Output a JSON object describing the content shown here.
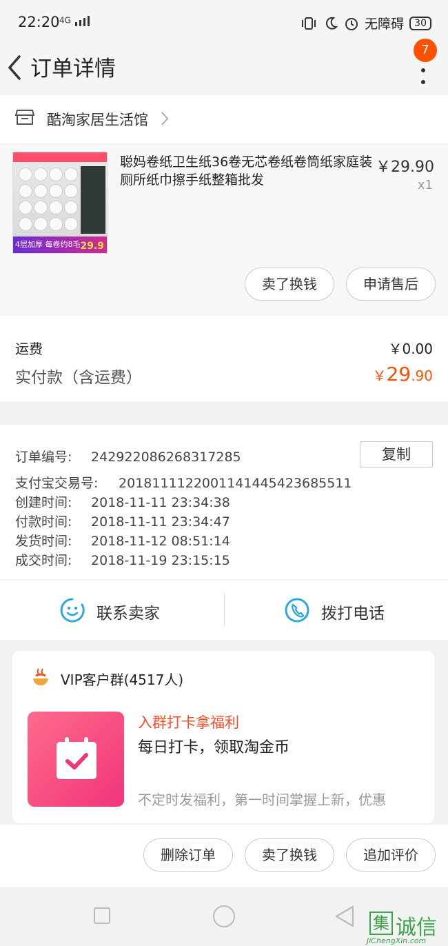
{
  "status_bar": {
    "time": "22:20",
    "signal": "4G",
    "accessibility": "无障碍",
    "battery": "30"
  },
  "header": {
    "title": "订单详情",
    "badge": "7"
  },
  "shop": {
    "name": "酷淘家居生活馆"
  },
  "product": {
    "title": "聪妈卷纸卫生纸36卷无芯卷纸卷筒纸家庭装厕所纸巾擦手纸整箱批发",
    "price": "￥29.90",
    "qty": "x1",
    "thumb_banner": "4层加厚 每卷约8毛",
    "thumb_price": "29.9",
    "buttons": {
      "sell": "卖了换钱",
      "after_sale": "申请售后"
    }
  },
  "fees": {
    "shipping_label": "运费",
    "shipping_value": "￥0.00",
    "paid_label": "实付款（含运费）",
    "paid_currency": "￥",
    "paid_int": "29",
    "paid_dec": ".90"
  },
  "order_info": {
    "order_no_label": "订单编号:",
    "order_no": "242922086268317285",
    "copy_label": "复制",
    "alipay_label": "支付宝交易号:",
    "alipay_no": "2018111122001141445423685511",
    "created_label": "创建时间:",
    "created": "2018-11-11 23:34:38",
    "paid_label": "付款时间:",
    "paid": "2018-11-11 23:34:47",
    "shipped_label": "发货时间:",
    "shipped": "2018-11-12 08:51:14",
    "closed_label": "成交时间:",
    "closed": "2018-11-19 23:15:15"
  },
  "contact": {
    "seller": "联系卖家",
    "phone": "拨打电话"
  },
  "vip": {
    "title": "VIP客户群(4517人)",
    "headline": "入群打卡拿福利",
    "sub": "每日打卡，领取淘金币",
    "desc": "不定时发福利，第一时间掌握上新，优惠"
  },
  "actions": {
    "delete": "删除订单",
    "sell": "卖了换钱",
    "review": "追加评价"
  },
  "watermark": {
    "box": "集",
    "text": "诚信",
    "url": "JiChengXin.com"
  },
  "colors": {
    "accent": "#ff5000",
    "contact_blue": "#2ea7e0",
    "vip_tile": "#f0357a"
  },
  "icons": [
    "back-arrow-icon",
    "more-vertical-icon",
    "shop-icon",
    "chevron-right-icon",
    "smile-chat-icon",
    "phone-icon",
    "vip-logo-icon",
    "calendar-check-icon",
    "nav-square-icon",
    "nav-home-circle-icon",
    "nav-back-triangle-icon"
  ]
}
